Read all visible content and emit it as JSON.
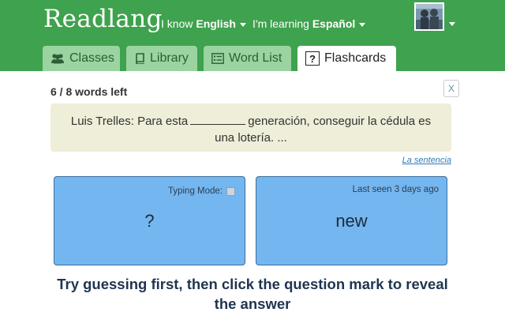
{
  "header": {
    "brand": "Readlang",
    "i_know_prefix": "I know",
    "i_know_lang": "English",
    "learning_prefix": "I'm learning",
    "learning_lang": "Español",
    "bg_color": "#3fa24e"
  },
  "tabs": [
    {
      "label": "Classes",
      "icon": "users-icon",
      "active": false
    },
    {
      "label": "Library",
      "icon": "book-icon",
      "active": false
    },
    {
      "label": "Word List",
      "icon": "list-icon",
      "active": false
    },
    {
      "label": "Flashcards",
      "icon": "question-box-icon",
      "active": true
    }
  ],
  "main": {
    "words_left": "6 / 8 words left",
    "close_label": "X",
    "sentence": {
      "before": "Luis Trelles: Para esta",
      "after": "generación, conseguir la cédula es una lotería.  ..."
    },
    "sentence_link": "La sentencia",
    "card_left": {
      "typing_mode_label": "Typing Mode:",
      "prompt": "?"
    },
    "card_right": {
      "last_seen": "Last seen 3 days ago",
      "word": "new"
    },
    "hint": "Try guessing first, then click the question mark to reveal the answer"
  }
}
